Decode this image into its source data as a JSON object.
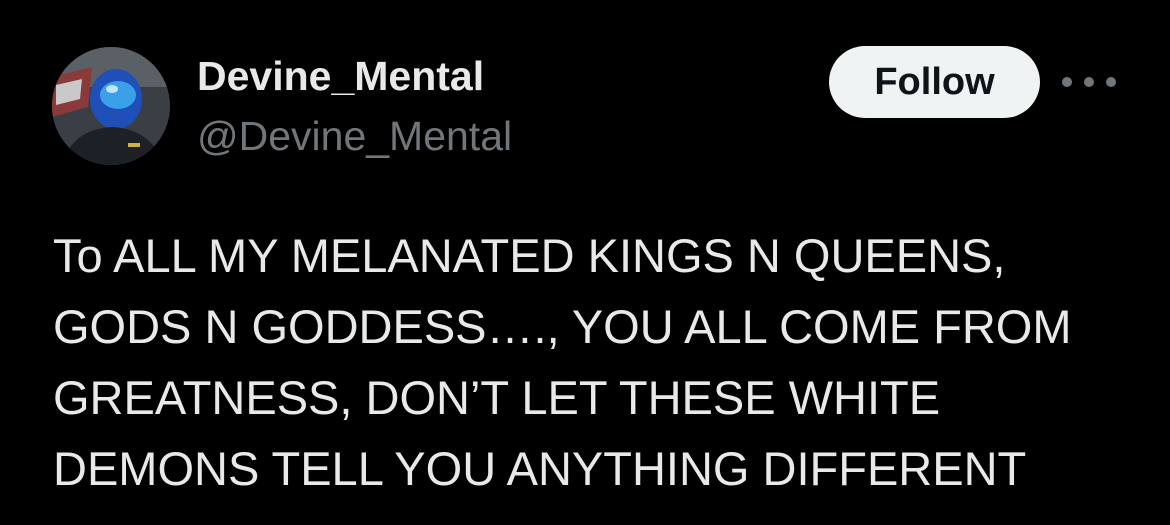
{
  "author": {
    "display_name": "Devine_Mental",
    "handle": "@Devine_Mental",
    "avatar_icon": "helmet-avatar"
  },
  "actions": {
    "follow_label": "Follow",
    "more_icon": "more-horizontal-icon"
  },
  "tweet": {
    "lines": [
      "To ALL MY MELANATED KINGS N QUEENS,",
      "GODS N GODDESS…., YOU ALL COME FROM",
      "GREATNESS, DON’T LET THESE WHITE",
      "DEMONS TELL YOU ANYTHING DIFFERENT"
    ]
  },
  "colors": {
    "background": "#000000",
    "primary_text": "#e7e9ea",
    "secondary_text": "#71767b",
    "follow_bg": "#eff3f4",
    "follow_text": "#0f1419"
  }
}
